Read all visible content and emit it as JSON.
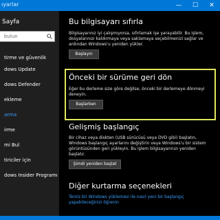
{
  "window": {
    "title": "ıyarlar",
    "controls": {
      "minimize": "—",
      "maximize": "☐",
      "close": "✕"
    }
  },
  "sidebar": {
    "title": "Sayfa",
    "search_placeholder": "bulun",
    "section": "tirme ve güvenlik",
    "items": [
      {
        "label": "dows Update",
        "active": false
      },
      {
        "label": "dows Defender",
        "active": false
      },
      {
        "label": "ekleme",
        "active": false
      },
      {
        "label": "arma",
        "active": true
      },
      {
        "label": "irme",
        "active": false
      },
      {
        "label": "mi Bul",
        "active": false
      },
      {
        "label": "tiriciler için",
        "active": false
      },
      {
        "label": "dows Insider Programı",
        "active": false
      }
    ]
  },
  "main": {
    "reset": {
      "heading": "Bu bilgisayarı sıfırla",
      "description": "Bilgisayarınız iyi çalışmıyorsa, sıfırlamak işe yarayabilir. Bu işlem, dosyalarınızı kaldırmaya veya saklamaya seçebilmenizi sağlar ve ardından Windows'u yeniden yükler.",
      "button": "Başlayın"
    },
    "rollback": {
      "heading": "Önceki bir sürüme geri dön",
      "description": "Eğer bu derleme size göre değilse, önceki bir derlemeye dönmeyi deneyin.",
      "button": "Başlarken"
    },
    "advanced": {
      "heading": "Gelişmiş başlangıç",
      "description": "Bir cihaz veya diskten (USB sürücüsü veya DVD gibi) başlatın, Windows başlangıç ayarlarını değiştirin veya Windows'u bir sistem görüntüsünden geri yükleyin. Bu işlem bilgisayarınızı yeniden başlatır.",
      "button": "Şimdi yeniden başlat"
    },
    "other": {
      "heading": "Diğer kurtarma seçenekleri",
      "link": "Temiz bir Windows yüklemesi ile nasıl yeni bir başlangıç yapabileceğinizi öğrenin"
    }
  },
  "colors": {
    "accent": "#0078d7",
    "highlight": "#e3e85a",
    "link": "#3aa0ff"
  }
}
